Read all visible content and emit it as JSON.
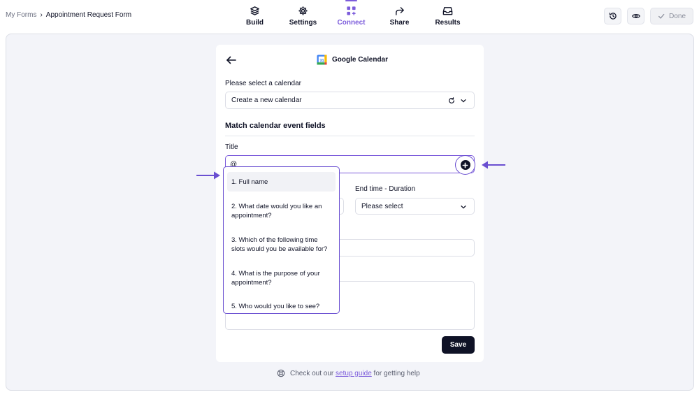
{
  "breadcrumb": {
    "root": "My Forms",
    "separator": "›",
    "current": "Appointment Request Form"
  },
  "nav": {
    "build": "Build",
    "settings": "Settings",
    "connect": "Connect",
    "share": "Share",
    "results": "Results",
    "active": "Connect"
  },
  "top_actions": {
    "done_label": "Done"
  },
  "panel": {
    "title": "Google Calendar",
    "calendar_label": "Please select a calendar",
    "calendar_value": "Create a new calendar",
    "section_title": "Match calendar event fields",
    "title_label": "Title",
    "title_value": "@",
    "end_time_label": "End time - Duration",
    "end_time_value": "Please select",
    "save_label": "Save"
  },
  "dropdown": {
    "items": [
      "1. Full name",
      "2. What date would you like an appointment?",
      "3. Which of the following time slots would you be available for?",
      "4. What is the purpose of your appointment?",
      "5. Who would you like to see?"
    ]
  },
  "help": {
    "prefix": "Check out our",
    "link": "setup guide",
    "suffix": "for getting help"
  },
  "colors": {
    "accent": "#7c5cdb",
    "dark": "#0f1226",
    "canvas": "#f3f4f9"
  }
}
